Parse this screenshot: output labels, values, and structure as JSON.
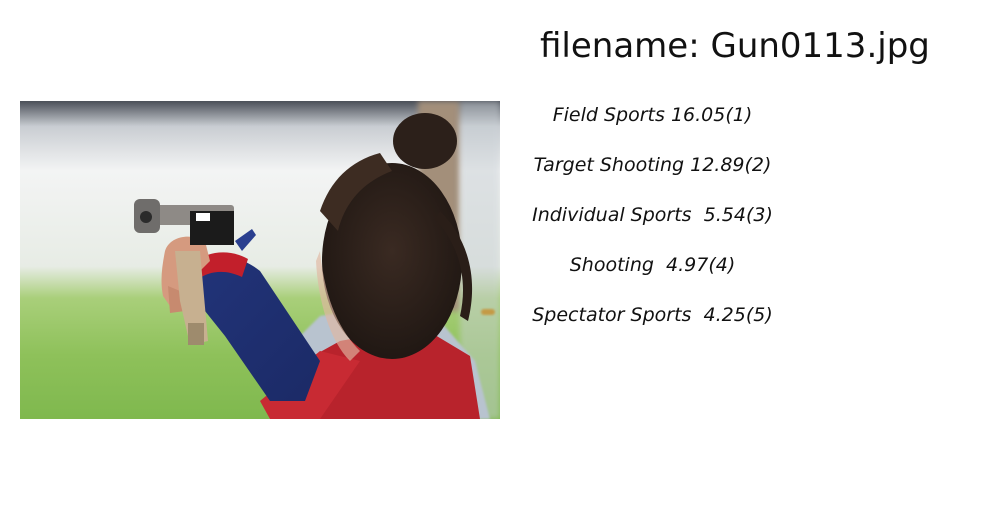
{
  "filename_prefix": "filename: ",
  "filename": "Gun0113.jpg",
  "predictions": [
    {
      "label": "Field Sports",
      "score": "16.05",
      "rank": "(1)",
      "sep": " "
    },
    {
      "label": "Target Shooting",
      "score": "12.89",
      "rank": "(2)",
      "sep": " "
    },
    {
      "label": "Individual Sports",
      "score": "5.54",
      "rank": "(3)",
      "sep": "  "
    },
    {
      "label": "Shooting",
      "score": "4.97",
      "rank": "(4)",
      "sep": "  "
    },
    {
      "label": "Spectator Sports",
      "score": "4.25",
      "rank": "(5)",
      "sep": "  "
    }
  ]
}
